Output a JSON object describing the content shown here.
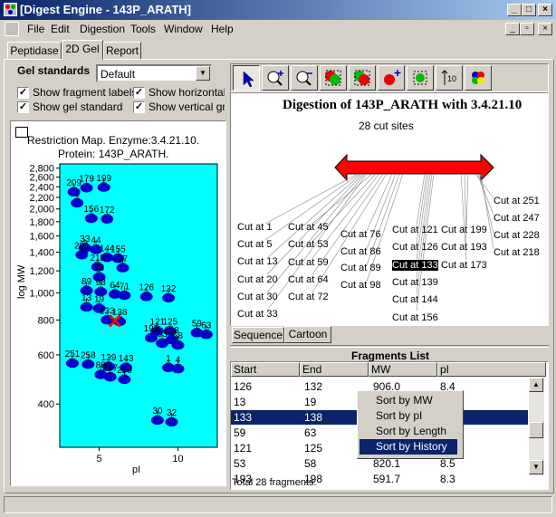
{
  "window": {
    "title": "[Digest Engine - 143P_ARATH]"
  },
  "menu": [
    "File",
    "Edit",
    "Digestion",
    "Tools",
    "Window",
    "Help"
  ],
  "tabs": [
    "Peptidase",
    "2D Gel",
    "Report"
  ],
  "gel": {
    "standards_label": "Gel standards",
    "standard_value": "Default",
    "checkboxes": [
      {
        "label": "Show fragment labels",
        "checked": true
      },
      {
        "label": "Show horizontal g",
        "checked": true
      },
      {
        "label": "Show gel standard",
        "checked": true
      },
      {
        "label": "Show vertical grid",
        "checked": true
      }
    ],
    "title1": "Restriction Map. Enzyme:3.4.21.10.",
    "title2": "Protein: 143P_ARATH.",
    "ylabel": "log MW",
    "xlabel": "pI"
  },
  "chart_data": {
    "type": "scatter",
    "title": "Restriction Map. Enzyme:3.4.21.10.",
    "subtitle": "Protein: 143P_ARATH.",
    "xlabel": "pI",
    "ylabel": "log MW",
    "x_ticks": [
      "5",
      "10"
    ],
    "y_ticks": [
      "2,800",
      "2,600",
      "2,400",
      "2,200",
      "2,000",
      "1,800",
      "1,600",
      "1,400",
      "1,200",
      "1,000",
      "800",
      "600",
      "400"
    ],
    "xlim": [
      2.5,
      12.5
    ],
    "ylim": [
      280,
      2900
    ],
    "y_scale": "log",
    "points": [
      {
        "label": "179",
        "pi": 4.2,
        "mw": 2380
      },
      {
        "label": "199",
        "pi": 5.3,
        "mw": 2390
      },
      {
        "label": "209",
        "pi": 3.4,
        "mw": 2300
      },
      {
        "label": "1",
        "pi": 3.6,
        "mw": 2100
      },
      {
        "label": "156",
        "pi": 4.5,
        "mw": 1850
      },
      {
        "label": "172",
        "pi": 5.5,
        "mw": 1840
      },
      {
        "label": "33",
        "pi": 4.1,
        "mw": 1450
      },
      {
        "label": "44",
        "pi": 4.8,
        "mw": 1430
      },
      {
        "label": "201",
        "pi": 3.9,
        "mw": 1370
      },
      {
        "label": "144",
        "pi": 5.5,
        "mw": 1340
      },
      {
        "label": "155",
        "pi": 6.2,
        "mw": 1330
      },
      {
        "label": "218",
        "pi": 4.9,
        "mw": 1240
      },
      {
        "label": "27",
        "pi": 6.5,
        "mw": 1230
      },
      {
        "label": "76",
        "pi": 5.0,
        "mw": 1140
      },
      {
        "label": "89",
        "pi": 4.2,
        "mw": 1020
      },
      {
        "label": "98",
        "pi": 5.1,
        "mw": 1010
      },
      {
        "label": "64",
        "pi": 6.0,
        "mw": 990
      },
      {
        "label": "71",
        "pi": 6.6,
        "mw": 980
      },
      {
        "label": "126",
        "pi": 8.0,
        "mw": 970
      },
      {
        "label": "132",
        "pi": 9.4,
        "mw": 960
      },
      {
        "label": "13",
        "pi": 4.2,
        "mw": 890
      },
      {
        "label": "19",
        "pi": 5.0,
        "mw": 880
      },
      {
        "label": "133",
        "pi": 5.5,
        "mw": 800
      },
      {
        "label": "138",
        "pi": 6.3,
        "mw": 790
      },
      {
        "label": "121",
        "pi": 8.7,
        "mw": 730
      },
      {
        "label": "125",
        "pi": 9.5,
        "mw": 730
      },
      {
        "label": "59",
        "pi": 11.2,
        "mw": 720
      },
      {
        "label": "63",
        "pi": 11.8,
        "mw": 710
      },
      {
        "label": "193",
        "pi": 8.3,
        "mw": 690
      },
      {
        "label": "198",
        "pi": 9.6,
        "mw": 680
      },
      {
        "label": "53",
        "pi": 9.0,
        "mw": 660
      },
      {
        "label": "58",
        "pi": 10.0,
        "mw": 650
      },
      {
        "label": "251",
        "pi": 3.3,
        "mw": 560
      },
      {
        "label": "258",
        "pi": 4.3,
        "mw": 555
      },
      {
        "label": "139",
        "pi": 5.6,
        "mw": 545
      },
      {
        "label": "143",
        "pi": 6.7,
        "mw": 540
      },
      {
        "label": "1",
        "pi": 9.4,
        "mw": 540
      },
      {
        "label": "4",
        "pi": 10.0,
        "mw": 535
      },
      {
        "label": "86",
        "pi": 5.1,
        "mw": 510
      },
      {
        "label": "247",
        "pi": 5.7,
        "mw": 500
      },
      {
        "label": "250",
        "pi": 6.6,
        "mw": 490
      },
      {
        "label": "30",
        "pi": 8.7,
        "mw": 350
      },
      {
        "label": "32",
        "pi": 9.6,
        "mw": 345
      }
    ],
    "highlight": {
      "label": "133",
      "pi": 6.0,
      "mw": 795
    }
  },
  "digest": {
    "title": "Digestion of 143P_ARATH with 3.4.21.10",
    "subtitle": "28 cut sites",
    "cuts_left": [
      "Cut at 1",
      "Cut at 5",
      "Cut at 13",
      "Cut at 20",
      "Cut at 30",
      "Cut at 33"
    ],
    "cuts_col2": [
      "Cut at 45",
      "Cut at 53",
      "Cut at 59",
      "Cut at 64",
      "Cut at 72"
    ],
    "cuts_col3": [
      "Cut at 76",
      "Cut at 86",
      "Cut at 89",
      "Cut at 98"
    ],
    "cuts_col4": [
      "Cut at 121",
      "Cut at 126",
      "Cut at 133",
      "Cut at 139",
      "Cut at 144",
      "Cut at 156"
    ],
    "cuts_col5": [
      "Cut at 199",
      "Cut at 193",
      "Cut at 173"
    ],
    "cuts_right": [
      "Cut at 251",
      "Cut at 247",
      "Cut at 228",
      "Cut at 218"
    ],
    "view_tabs": [
      "Sequence",
      "Cartoon"
    ]
  },
  "fragments": {
    "title": "Fragments List",
    "columns": [
      "Start",
      "End",
      "MW",
      "pI"
    ],
    "rows": [
      [
        "126",
        "132",
        "906.0",
        "8.4"
      ],
      [
        "13",
        "19",
        "",
        ""
      ],
      [
        "133",
        "138",
        "",
        ""
      ],
      [
        "59",
        "63",
        "",
        ""
      ],
      [
        "121",
        "125",
        "",
        ""
      ],
      [
        "53",
        "58",
        "820.1",
        "8.5"
      ],
      [
        "193",
        "198",
        "591.7",
        "8.3"
      ]
    ],
    "footer": "Total 28 fragments.",
    "context_menu": [
      "Sort by MW",
      "Sort by pI",
      "Sort by Length",
      "Sort by History"
    ]
  }
}
